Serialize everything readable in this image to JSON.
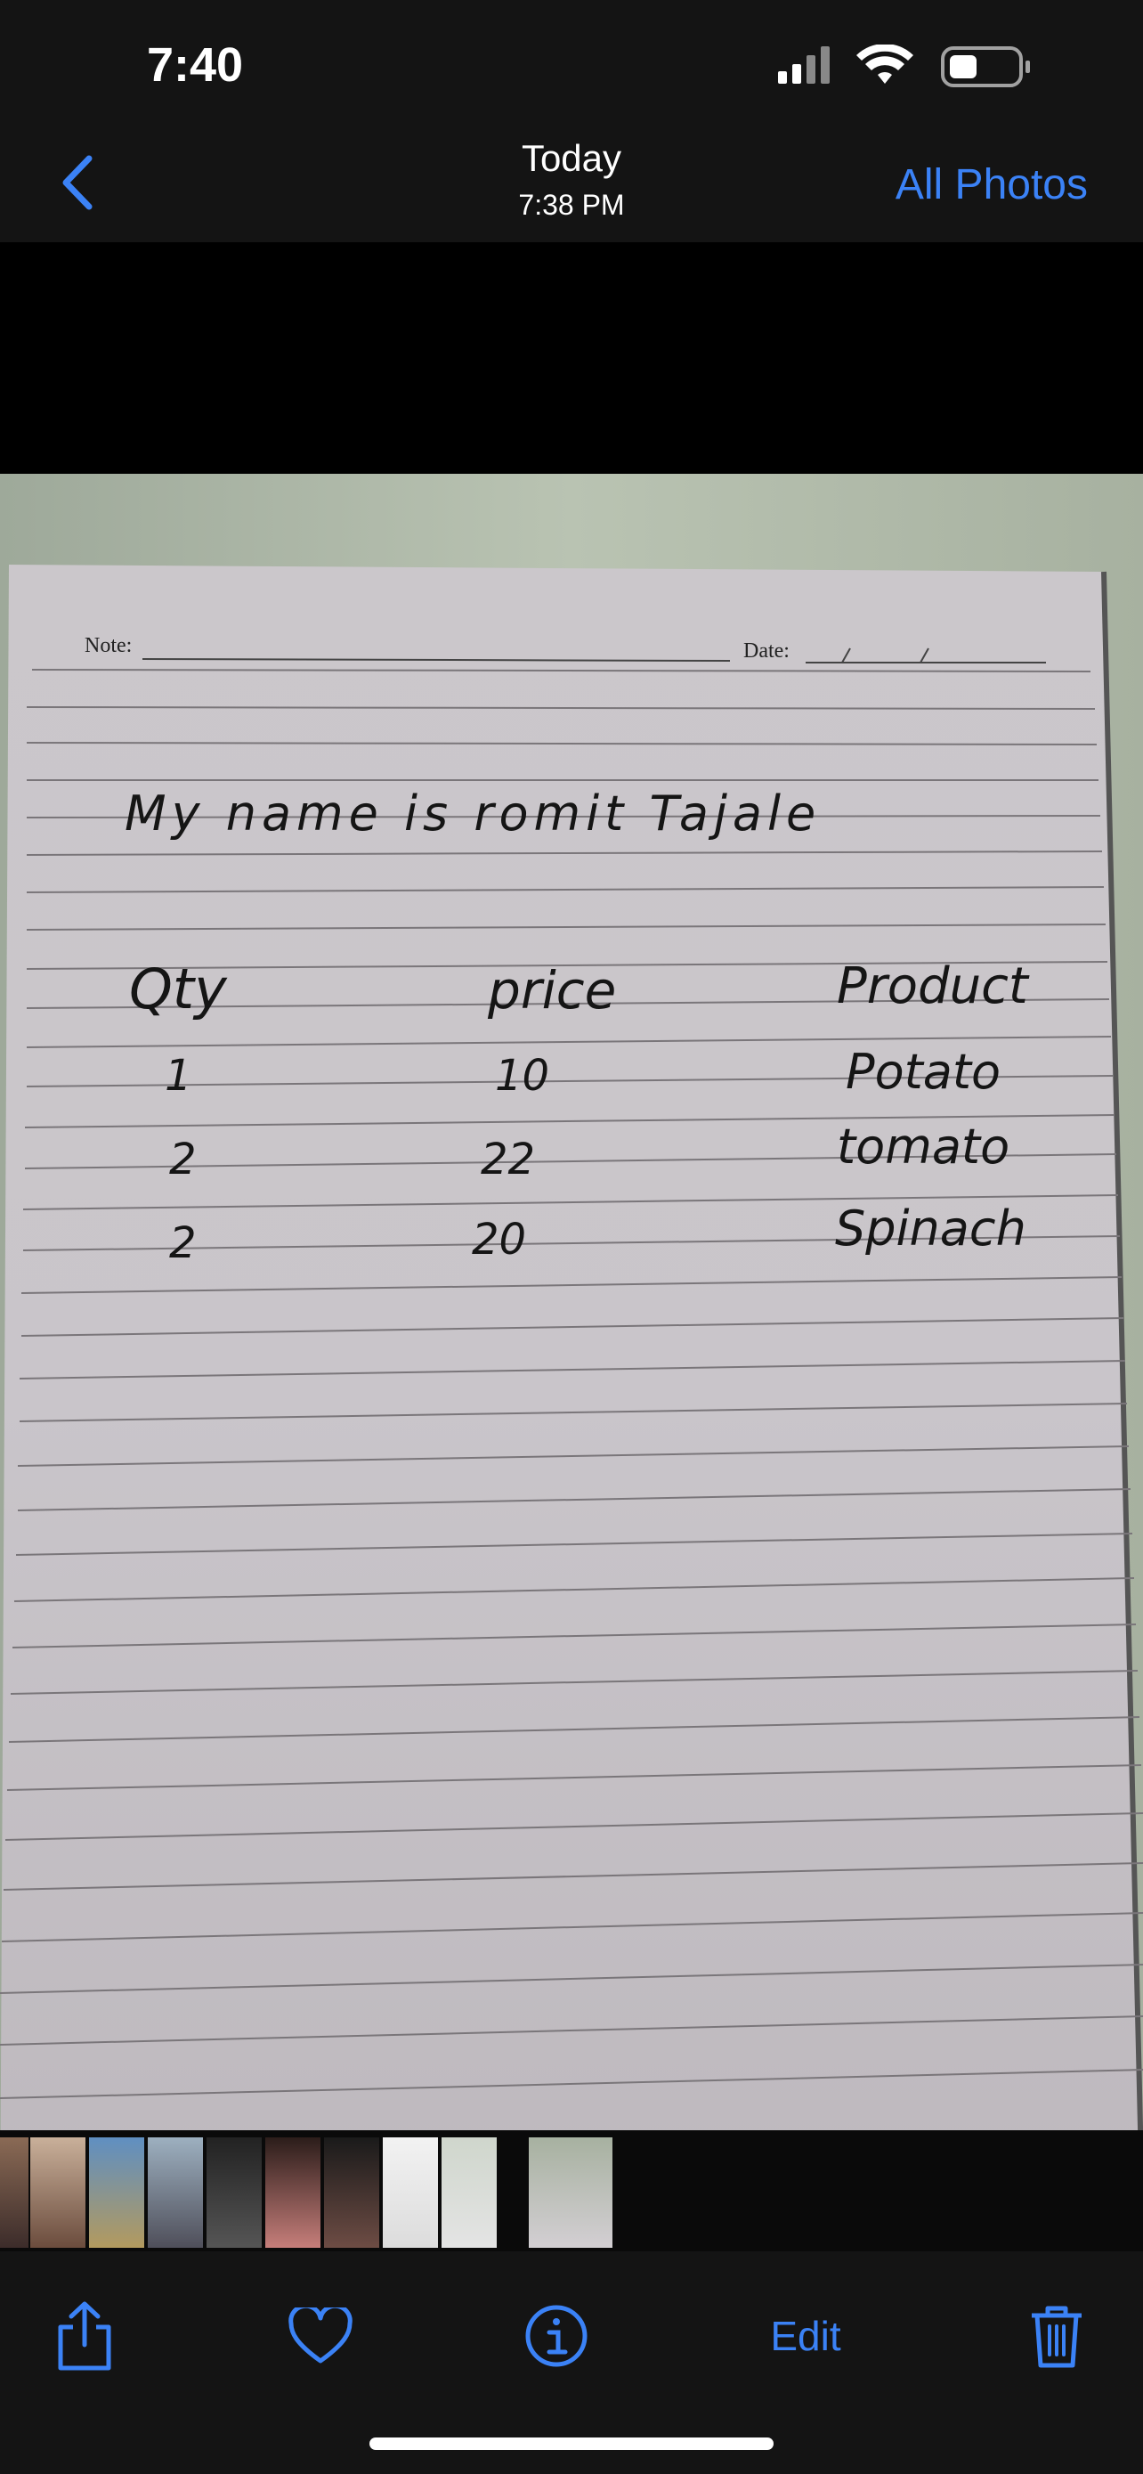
{
  "status_bar": {
    "time": "7:40"
  },
  "nav": {
    "title": "Today",
    "subtitle": "7:38 PM",
    "all_photos_label": "All Photos"
  },
  "photo": {
    "note_label": "Note:",
    "date_label": "Date:",
    "handwritten_name": "My name is romit Tajale",
    "table_headers": [
      "Qty",
      "price",
      "Product"
    ],
    "table_rows": [
      [
        "1",
        "10",
        "Potato"
      ],
      [
        "2",
        "22",
        "tomato"
      ],
      [
        "2",
        "20",
        "Spinach"
      ]
    ]
  },
  "toolbar": {
    "share_icon": "share-icon",
    "favorite_icon": "heart-icon",
    "info_icon": "info-icon",
    "edit_label": "Edit",
    "delete_icon": "trash-icon"
  },
  "colors": {
    "accent": "#3b82f6",
    "bar_bg": "#141414"
  }
}
